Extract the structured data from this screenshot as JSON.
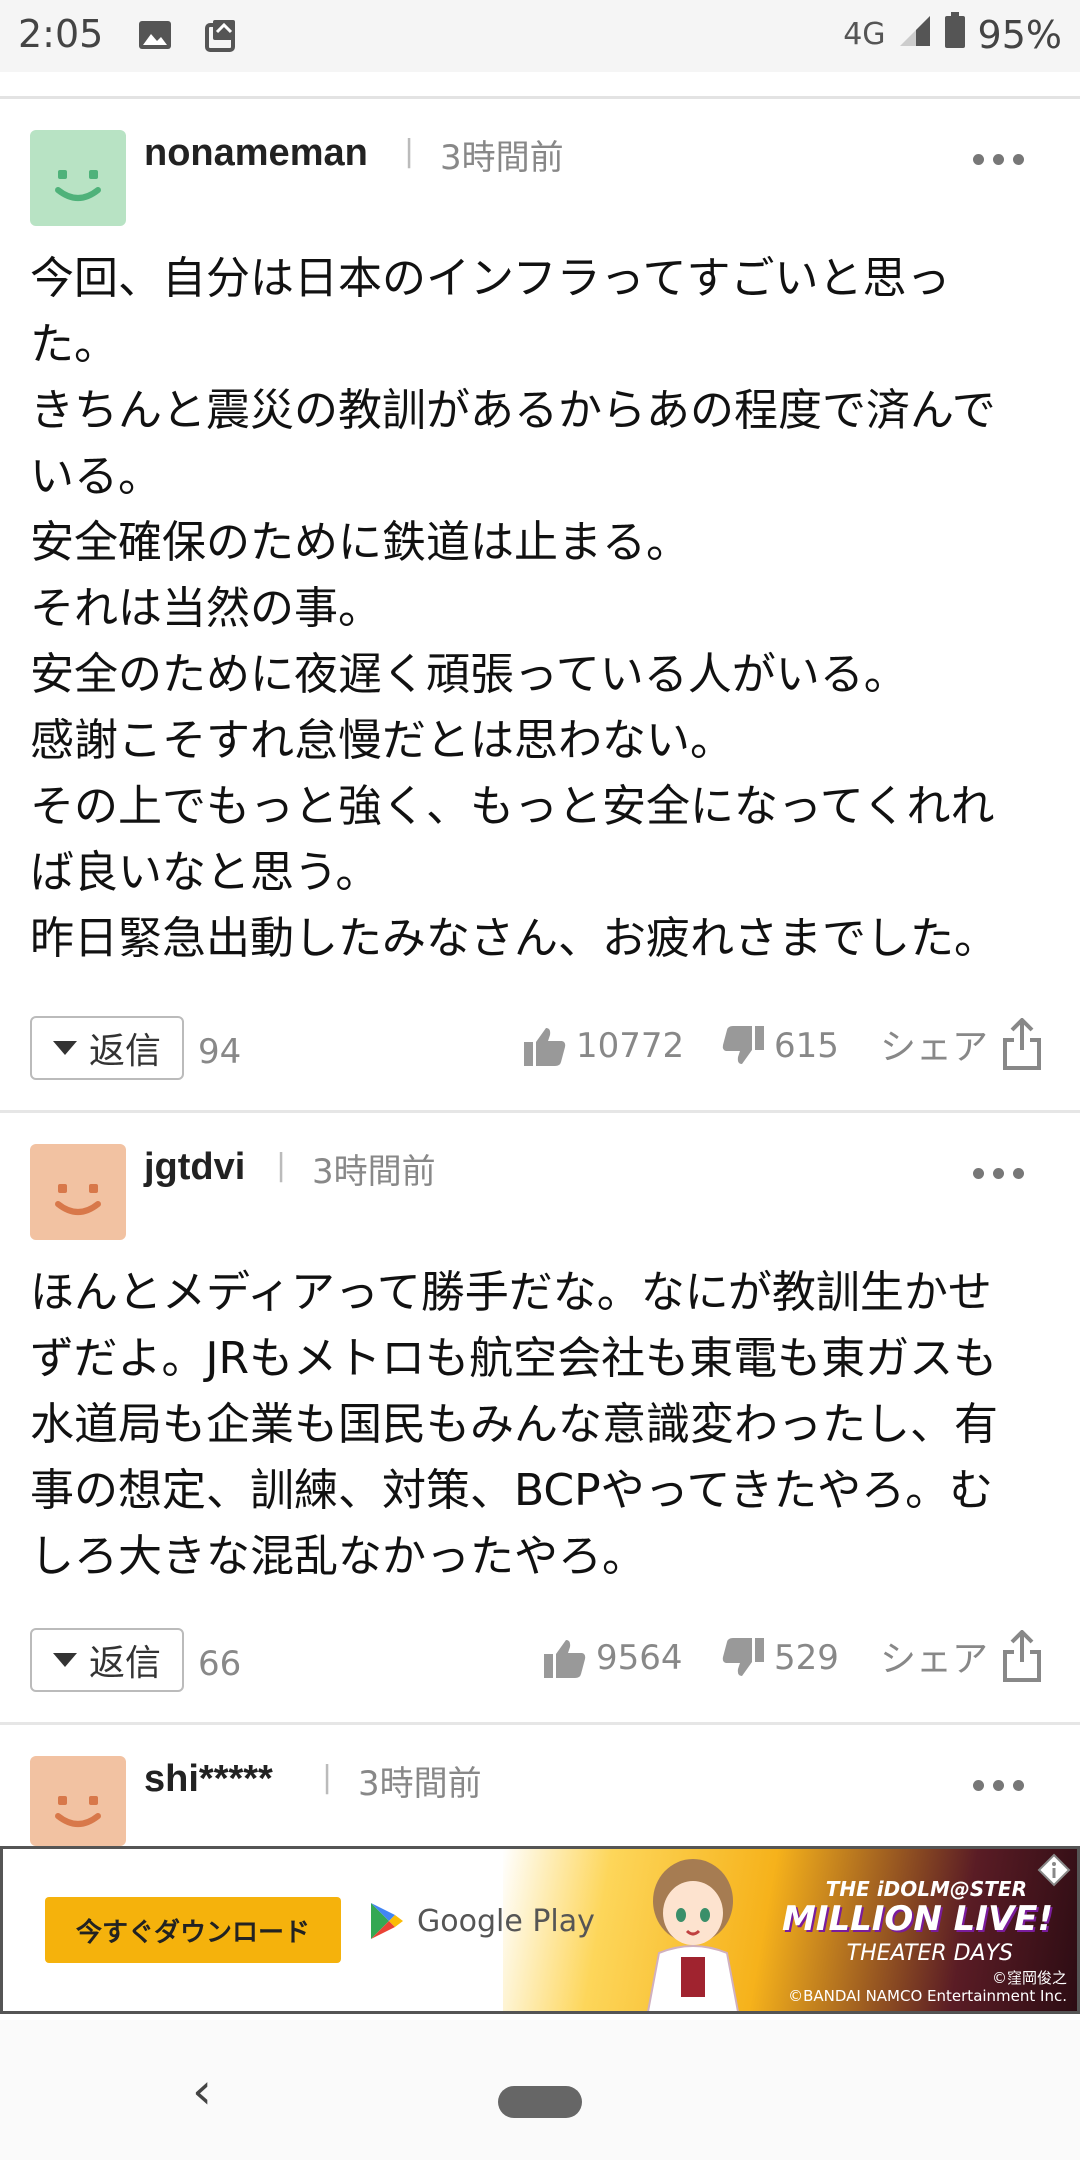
{
  "status_bar": {
    "time": "2:05",
    "network": "4G",
    "battery": "95%"
  },
  "comments": [
    {
      "username": "nonameman",
      "time": "3時間前",
      "avatar_color": "#b8e3c4",
      "avatar_face_color": "#4fb27a",
      "body": "今回、自分は日本のインフラってすごいと思っ\nた。\nきちんと震災の教訓があるからあの程度で済んで\nいる。\n安全確保のために鉄道は止まる。\nそれは当然の事。\n安全のために夜遅く頑張っている人がいる。\n感謝こそすれ怠慢だとは思わない。\nその上でもっと強く、もっと安全になってくれれ\nば良いなと思う。\n昨日緊急出動したみなさん、お疲れさまでした。",
      "reply_label": "返信",
      "reply_count": "94",
      "likes": "10772",
      "dislikes": "615",
      "share_label": "シェア"
    },
    {
      "username": "jgtdvi",
      "time": "3時間前",
      "avatar_color": "#f2c2a2",
      "avatar_face_color": "#d8784a",
      "body": "ほんとメディアって勝手だな。なにが教訓生かせ\nずだよ。JRもメトロも航空会社も東電も東ガスも\n水道局も企業も国民もみんな意識変わったし、有\n事の想定、訓練、対策、BCPやってきたやろ。む\nしろ大きな混乱なかったやろ。",
      "reply_label": "返信",
      "reply_count": "66",
      "likes": "9564",
      "dislikes": "529",
      "share_label": "シェア"
    },
    {
      "username": "shi*****",
      "time": "3時間前",
      "avatar_color": "#f2c2a2",
      "avatar_face_color": "#d8784a"
    }
  ],
  "ad": {
    "button_label": "今すぐダウンロード",
    "store_label": "Google Play",
    "title_top": "THE iDOLM@STER",
    "title_main": "MILLION LIVE!",
    "title_sub": "THEATER DAYS",
    "copyright1": "©窪岡俊之",
    "copyright2": "©BANDAI NAMCO Entertainment Inc."
  }
}
